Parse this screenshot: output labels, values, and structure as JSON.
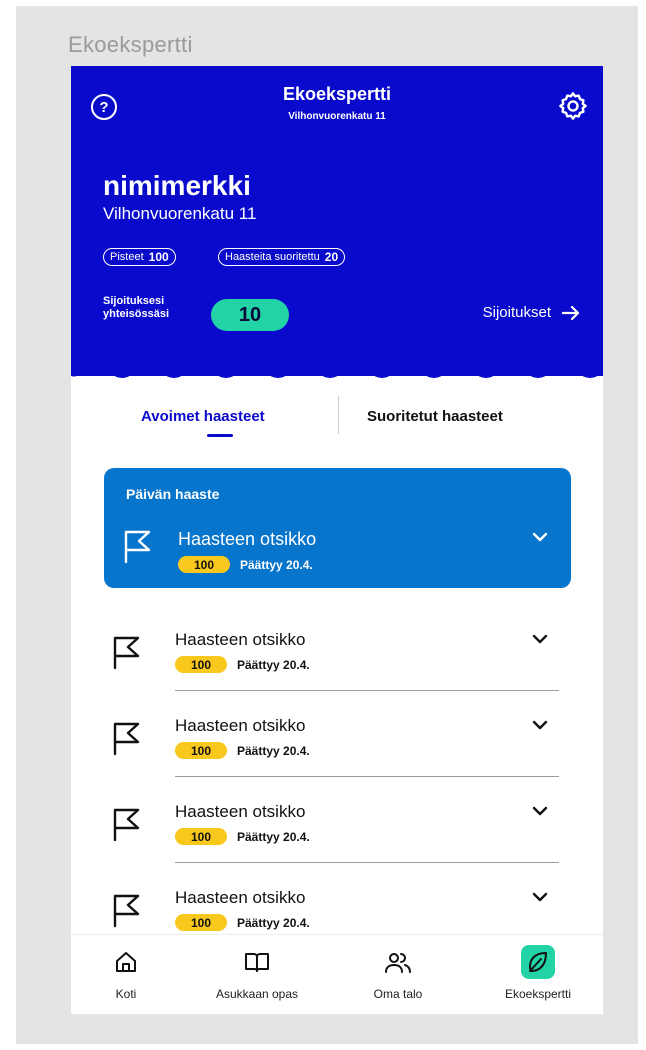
{
  "frame": {
    "title": "Ekoekspertti"
  },
  "header": {
    "app_title": "Ekoekspertti",
    "app_subtitle": "Vilhonvuorenkatu 11",
    "help_icon_text": "?",
    "nickname": "nimimerkki",
    "address": "Vilhonvuorenkatu 11",
    "points_label": "Pisteet",
    "points_value": "100",
    "challenges_label": "Haasteita suoritettu",
    "challenges_value": "20",
    "rank_label_line1": "Sijoituksesi",
    "rank_label_line2": "yhteisössäsi",
    "rank_value": "10",
    "rankings_link": "Sijoitukset",
    "colors": {
      "background": "#0a0acc",
      "rank_pill": "#22d3a5"
    }
  },
  "tabs": [
    {
      "label": "Avoimet haasteet",
      "active": true
    },
    {
      "label": "Suoritetut haasteet",
      "active": false
    }
  ],
  "daily_challenge": {
    "label": "Päivän haaste",
    "title": "Haasteen otsikko",
    "points": "100",
    "ends": "Päättyy 20.4.",
    "color": "#0775cb"
  },
  "challenges": [
    {
      "title": "Haasteen otsikko",
      "points": "100",
      "ends": "Päättyy 20.4."
    },
    {
      "title": "Haasteen otsikko",
      "points": "100",
      "ends": "Päättyy 20.4."
    },
    {
      "title": "Haasteen otsikko",
      "points": "100",
      "ends": "Päättyy 20.4."
    },
    {
      "title": "Haasteen otsikko",
      "points": "100",
      "ends": "Päättyy 20.4."
    }
  ],
  "bottom_nav": [
    {
      "label": "Koti",
      "icon": "home-icon",
      "active": false
    },
    {
      "label": "Asukkaan opas",
      "icon": "book-icon",
      "active": false
    },
    {
      "label": "Oma talo",
      "icon": "people-icon",
      "active": false
    },
    {
      "label": "Ekoekspertti",
      "icon": "leaf-icon",
      "active": true
    }
  ],
  "colors": {
    "badge": "#f9c81c",
    "active_nav_bg": "#22d3a5"
  }
}
